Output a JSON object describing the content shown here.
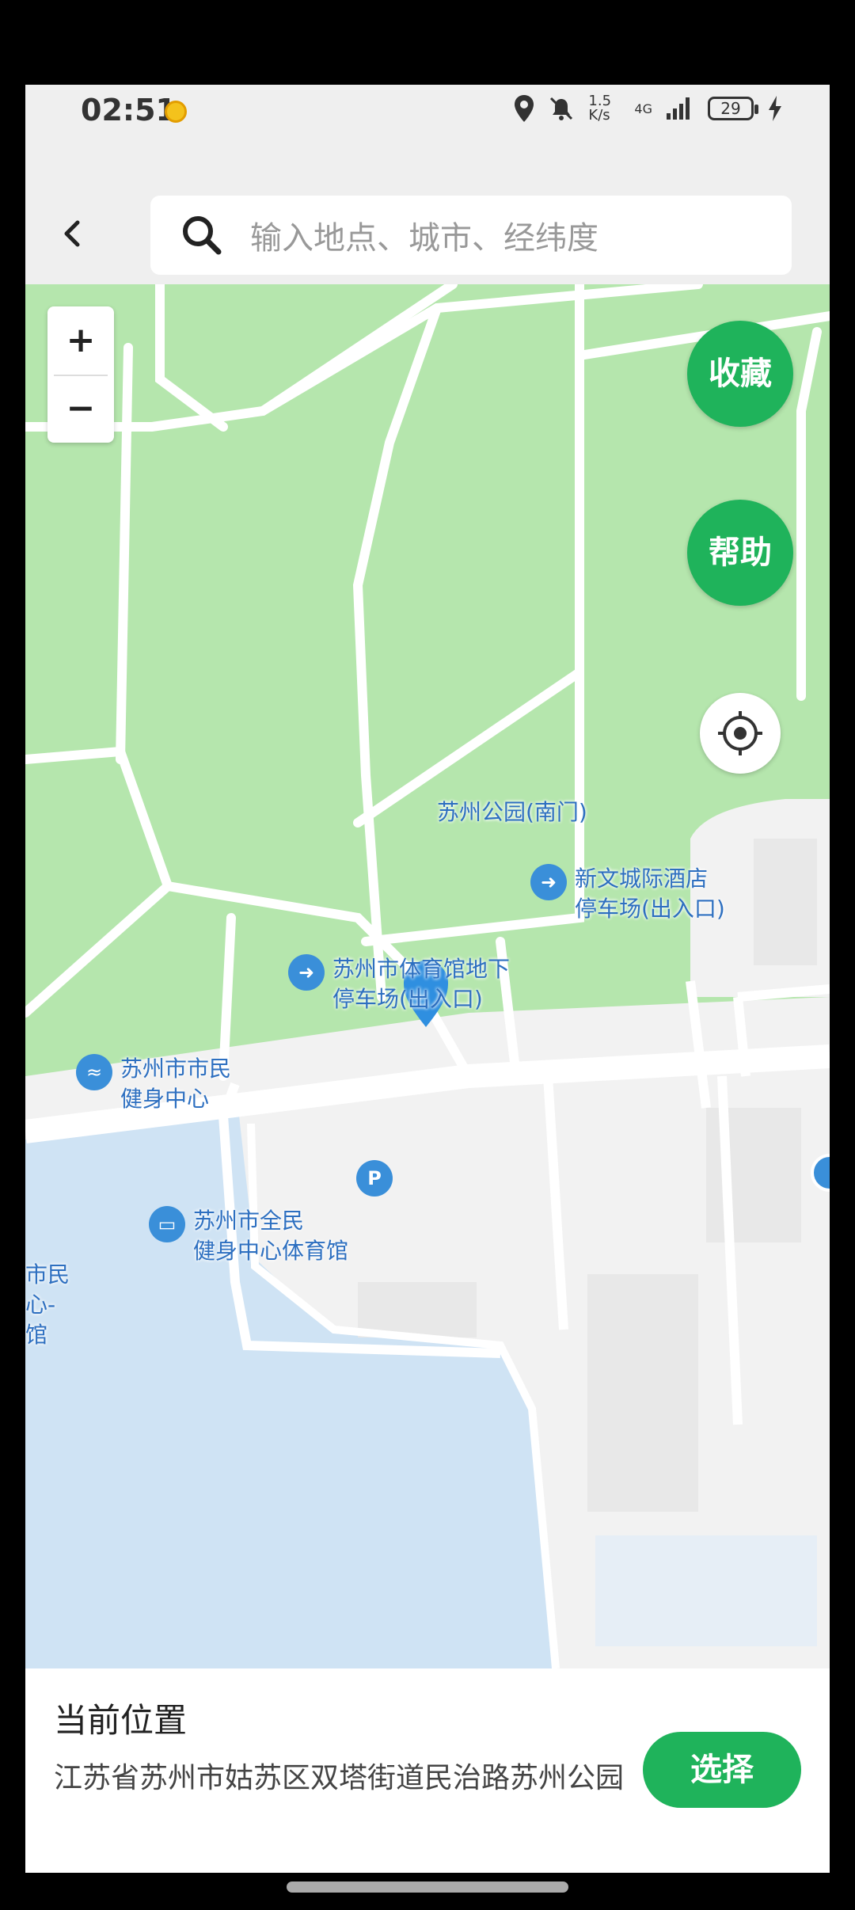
{
  "status_bar": {
    "time": "02:51",
    "net_speed": "1.5 K/s",
    "network": "4G",
    "battery": "29"
  },
  "search": {
    "placeholder": "输入地点、城市、经纬度"
  },
  "map": {
    "zoom_in": "+",
    "zoom_out": "−",
    "favorite_label": "收藏",
    "help_label": "帮助",
    "pois": [
      {
        "name": "苏州公园(南门)"
      },
      {
        "name": "新文城际酒店\n停车场(出入口)",
        "icon": "parking-entrance-icon"
      },
      {
        "name": "苏州市体育馆地下\n停车场(出入口)",
        "icon": "parking-entrance-icon"
      },
      {
        "name": "苏州市市民\n健身中心",
        "icon": "fitness-icon"
      },
      {
        "name": "P",
        "icon": "parking-icon"
      },
      {
        "name": "苏州市全民\n健身中心体育馆",
        "icon": "stadium-icon"
      },
      {
        "name": "市民\n心-\n馆"
      }
    ]
  },
  "panel": {
    "title": "当前位置",
    "address": "江苏省苏州市姑苏区双塔街道民治路苏州公园",
    "select_label": "选择"
  },
  "colors": {
    "accent": "#1fb35b",
    "park": "#b5e6ad",
    "water": "#cfe3f4",
    "poi": "#3a8fd9"
  }
}
